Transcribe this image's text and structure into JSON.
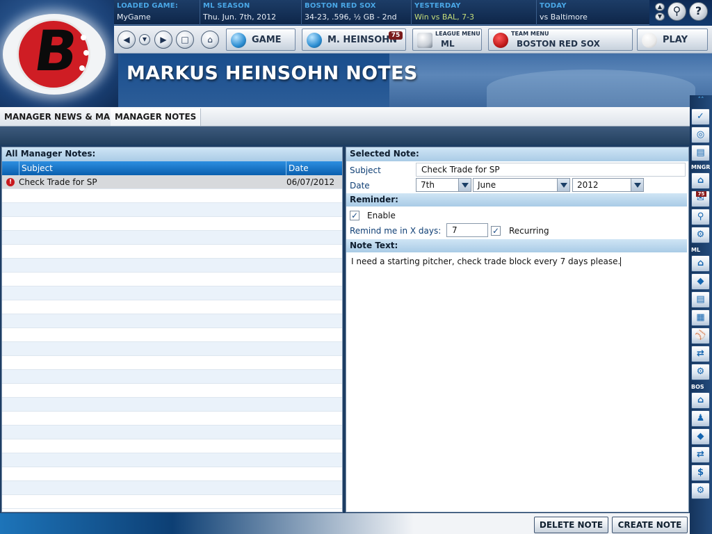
{
  "info_bar": {
    "loaded_game": {
      "label": "LOADED GAME:",
      "value": "MyGame"
    },
    "season": {
      "label": "ML SEASON",
      "value": "Thu. Jun. 7th, 2012"
    },
    "team": {
      "label": "BOSTON RED SOX",
      "value": "34-23, .596, ½ GB - 2nd"
    },
    "yesterday": {
      "label": "YESTERDAY",
      "value": "Win vs BAL, 7-3"
    },
    "today": {
      "label": "TODAY",
      "value": "vs Baltimore"
    }
  },
  "logo": {
    "letter": "B"
  },
  "nav": {
    "back_glyph": "◀",
    "down_glyph": "▼",
    "forward_glyph": "▶",
    "game_label": "GAME",
    "manager_label": "M. HEINSOHN",
    "manager_badge": "75",
    "league_menu_small": "LEAGUE MENU",
    "league_menu_label": "ML",
    "team_menu_small": "TEAM MENU",
    "team_menu_label": "BOSTON RED SOX",
    "play_label": "PLAY"
  },
  "page_title": "MARKUS HEINSOHN NOTES",
  "tabs": [
    {
      "label": "MANAGER NEWS & MAIL",
      "active": false
    },
    {
      "label": "MANAGER NOTES",
      "active": true
    }
  ],
  "notes_list": {
    "title": "All Manager Notes:",
    "columns": [
      "Subject",
      "Date"
    ],
    "rows": [
      {
        "subject": "Check Trade for SP",
        "date": "06/07/2012",
        "alert": "!"
      }
    ]
  },
  "selected_note": {
    "title": "Selected Note:",
    "subject_label": "Subject",
    "subject_value": "Check Trade for SP",
    "date_label": "Date",
    "date_day": "7th",
    "date_month": "June",
    "date_year": "2012",
    "reminder_title": "Reminder:",
    "enable_label": "Enable",
    "enable_checked": true,
    "remind_label": "Remind me in X days:",
    "remind_days": "7",
    "recurring_label": "Recurring",
    "recurring_checked": true,
    "note_text_title": "Note Text:",
    "note_text": "I need a starting pitcher, check trade block every 7 days please."
  },
  "footer": {
    "delete_label": "DELETE NOTE",
    "create_label": "CREATE NOTE"
  },
  "sidebar": {
    "collapse_glyph": "˄˄",
    "sections": [
      {
        "label": "MNGR"
      },
      {
        "label": "ML"
      },
      {
        "label": "BOS"
      }
    ],
    "mail_badge": "75"
  },
  "colors": {
    "accent": "#1b6fc4",
    "header_label": "#4aa7e6",
    "alert": "#c8191e",
    "logo_red": "#cf1d24"
  }
}
